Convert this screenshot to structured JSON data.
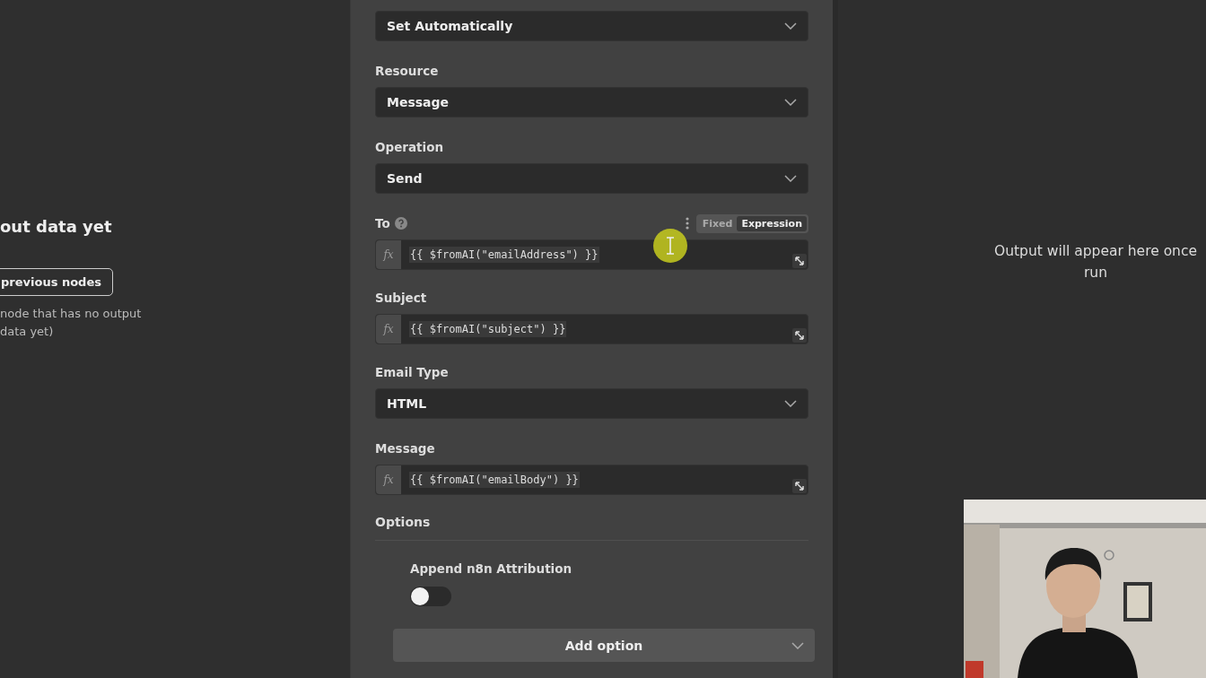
{
  "input_panel": {
    "title": "out data yet",
    "button": "previous nodes",
    "hint_lines": [
      "node that has no output",
      "data yet)"
    ]
  },
  "parameters": [
    {
      "kind": "select",
      "value": "Set Automatically"
    },
    {
      "kind": "select",
      "label": "Resource",
      "value": "Message"
    },
    {
      "kind": "select",
      "label": "Operation",
      "value": "Send"
    },
    {
      "kind": "expression",
      "label": "To",
      "help_icon": true,
      "modes": [
        {
          "label": "Fixed",
          "selected": false
        },
        {
          "label": "Expression",
          "selected": true
        }
      ],
      "prefix": "fx",
      "value": "{{ $fromAI(\"emailAddress\") }}"
    },
    {
      "kind": "expression",
      "label": "Subject",
      "prefix": "fx",
      "value": "{{ $fromAI(\"subject\") }}"
    },
    {
      "kind": "select",
      "label": "Email Type",
      "value": "HTML"
    },
    {
      "kind": "expression",
      "label": "Message",
      "prefix": "fx",
      "value": "{{ $fromAI(\"emailBody\") }}"
    }
  ],
  "options": {
    "title": "Options",
    "items": [
      {
        "label": "Append n8n Attribution",
        "on": false
      }
    ],
    "add_button": "Add option"
  },
  "output_panel": {
    "message": "Output will appear here once run"
  }
}
